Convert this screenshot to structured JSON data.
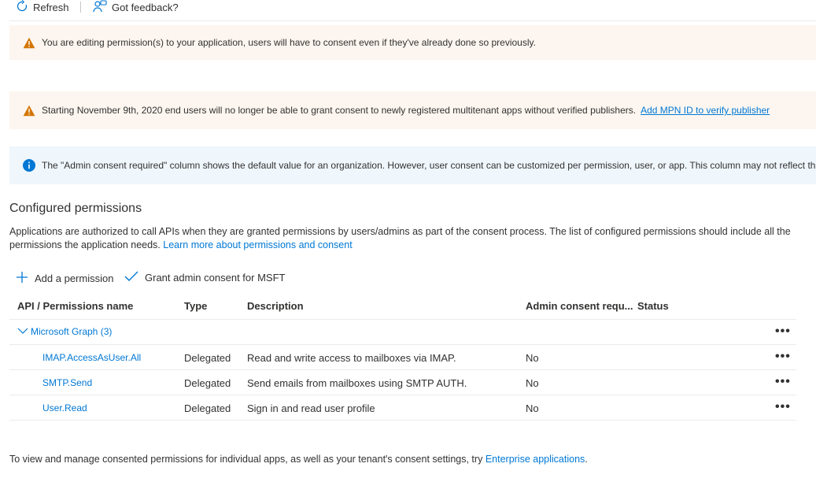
{
  "toolbar": {
    "refresh_label": "Refresh",
    "feedback_label": "Got feedback?"
  },
  "banners": {
    "editing_warning": "You are editing permission(s) to your application, users will have to consent even if they've already done so previously.",
    "publisher_warning": "Starting November 9th, 2020 end users will no longer be able to grant consent to newly registered multitenant apps without verified publishers.",
    "publisher_link": "Add MPN ID to verify publisher",
    "info_text": "The \"Admin consent required\" column shows the default value for an organization. However, user consent can be customized per permission, user, or app. This column may not reflect the"
  },
  "section": {
    "title": "Configured permissions",
    "description": "Applications are authorized to call APIs when they are granted permissions by users/admins as part of the consent process. The list of configured permissions should include all the permissions the application needs.",
    "learn_more": "Learn more about permissions and consent"
  },
  "commands": {
    "add_permission": "Add a permission",
    "grant_consent": "Grant admin consent for MSFT"
  },
  "table": {
    "headers": {
      "api": "API / Permissions name",
      "type": "Type",
      "description": "Description",
      "admin": "Admin consent requ...",
      "status": "Status"
    },
    "group_label": "Microsoft Graph (3)",
    "rows": [
      {
        "name": "IMAP.AccessAsUser.All",
        "type": "Delegated",
        "description": "Read and write access to mailboxes via IMAP.",
        "admin": "No"
      },
      {
        "name": "SMTP.Send",
        "type": "Delegated",
        "description": "Send emails from mailboxes using SMTP AUTH.",
        "admin": "No"
      },
      {
        "name": "User.Read",
        "type": "Delegated",
        "description": "Sign in and read user profile",
        "admin": "No"
      }
    ],
    "more_label": "•••"
  },
  "footer": {
    "text": "To view and manage consented permissions for individual apps, as well as your tenant's consent settings, try",
    "link": "Enterprise applications",
    "tail": "."
  },
  "colors": {
    "accent": "#0078d4",
    "warning_icon": "#d47500",
    "warning_bg": "#fdf6f0",
    "info_bg": "#eff6fc"
  }
}
